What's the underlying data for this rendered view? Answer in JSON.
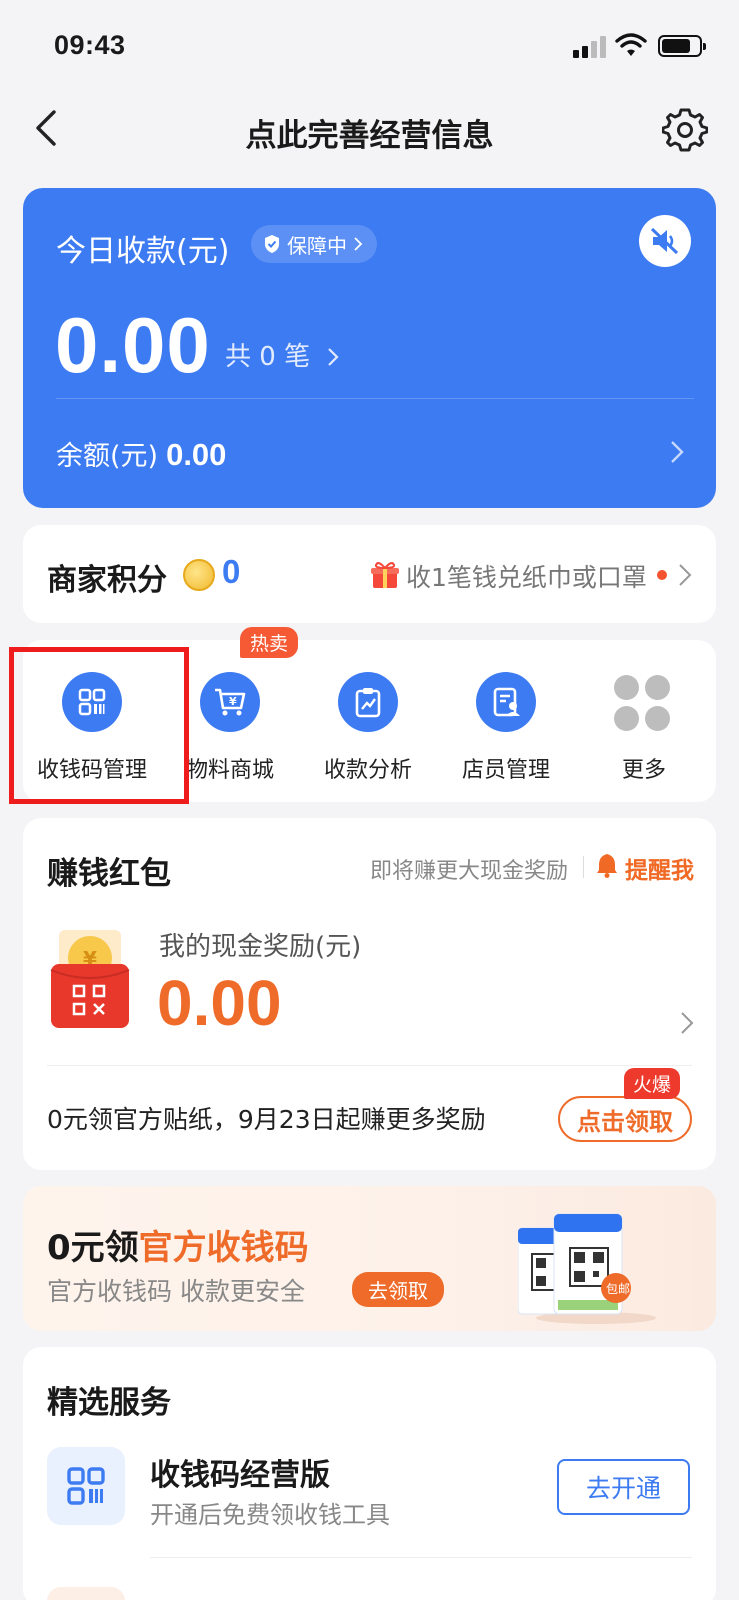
{
  "status_bar": {
    "time": "09:43"
  },
  "nav": {
    "title": "点此完善经营信息"
  },
  "revenue": {
    "today_label": "今日收款(元)",
    "guard_label": "保障中",
    "amount": "0.00",
    "count_label": "共 0 笔",
    "balance_label": "余额(元)",
    "balance_value": "0.00"
  },
  "points": {
    "label": "商家积分",
    "value": "0",
    "promo": "收1笔钱兑纸巾或口罩"
  },
  "menu": {
    "items": [
      {
        "label": "收钱码管理",
        "icon": "qr-code-icon"
      },
      {
        "label": "物料商城",
        "icon": "shopping-cart-icon"
      },
      {
        "label": "收款分析",
        "icon": "chart-clipboard-icon"
      },
      {
        "label": "店员管理",
        "icon": "staff-icon"
      },
      {
        "label": "更多",
        "icon": "more-grid-icon"
      }
    ],
    "hot_badge": "热卖"
  },
  "earn": {
    "title": "赚钱红包",
    "hint": "即将赚更大现金奖励",
    "remind": "提醒我",
    "reward_label": "我的现金奖励(元)",
    "reward_value": "0.00",
    "sticker_text": "0元领官方贴纸，9月23日起赚更多奖励",
    "claim_label": "点击领取",
    "fire_badge": "火爆"
  },
  "banner": {
    "title_part1": "0元领",
    "title_part2": "官方收钱码",
    "subtitle": "官方收钱码 收款更安全",
    "button": "去领取"
  },
  "services": {
    "title": "精选服务",
    "item_name": "收钱码经营版",
    "item_desc": "开通后免费领收钱工具",
    "item_button": "去开通"
  },
  "colors": {
    "brand_blue": "#3d7bf2",
    "accent_orange": "#ef6b2a",
    "highlight_red": "#ee1c1c"
  }
}
